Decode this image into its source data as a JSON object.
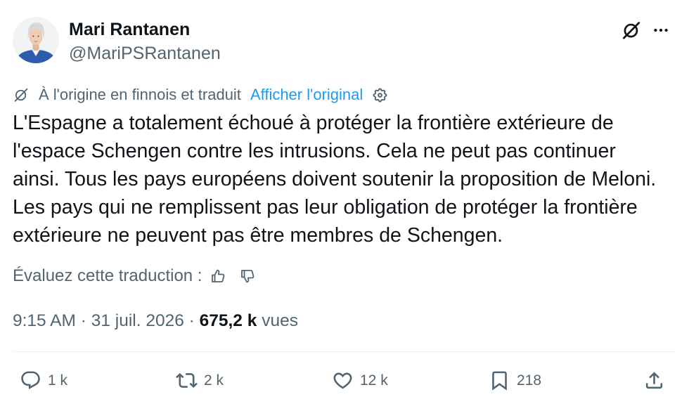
{
  "author": {
    "display_name": "Mari Rantanen",
    "handle": "@MariPSRantanen"
  },
  "header": {
    "grok_icon": "grok-icon",
    "more_icon": "more-icon"
  },
  "translation": {
    "icon": "grok-icon",
    "notice": "À l'origine en finnois et traduit",
    "show_original_label": "Afficher l'original",
    "settings_icon": "gear-icon"
  },
  "tweet": {
    "text_lines": [
      "L'Espagne a totalement échoué à protéger la frontière extérieure de",
      "l'espace Schengen contre les intrusions. Cela ne peut pas continuer",
      "ainsi. Tous les pays européens doivent soutenir la proposition de Meloni.",
      "Les pays qui ne remplissent pas leur obligation de protéger la frontière",
      "extérieure ne peuvent pas être membres de Schengen."
    ]
  },
  "rating": {
    "label": "Évaluez cette traduction :",
    "thumbs_up_icon": "thumbs-up-icon",
    "thumbs_down_icon": "thumbs-down-icon"
  },
  "meta": {
    "time": "9:15 AM",
    "separator": "·",
    "date": "31 juil. 2026",
    "views_count": "675,2 k",
    "views_label": "vues"
  },
  "actions": {
    "reply": {
      "icon": "reply-icon",
      "count": "1 k"
    },
    "repost": {
      "icon": "repost-icon",
      "count": "2 k"
    },
    "like": {
      "icon": "heart-icon",
      "count": "12 k"
    },
    "bookmark": {
      "icon": "bookmark-icon",
      "count": "218"
    },
    "share": {
      "icon": "share-icon"
    }
  },
  "colors": {
    "text_primary": "#0f1419",
    "text_secondary": "#536471",
    "accent": "#1d9bf0",
    "divider": "#eff3f4",
    "background": "#ffffff"
  }
}
